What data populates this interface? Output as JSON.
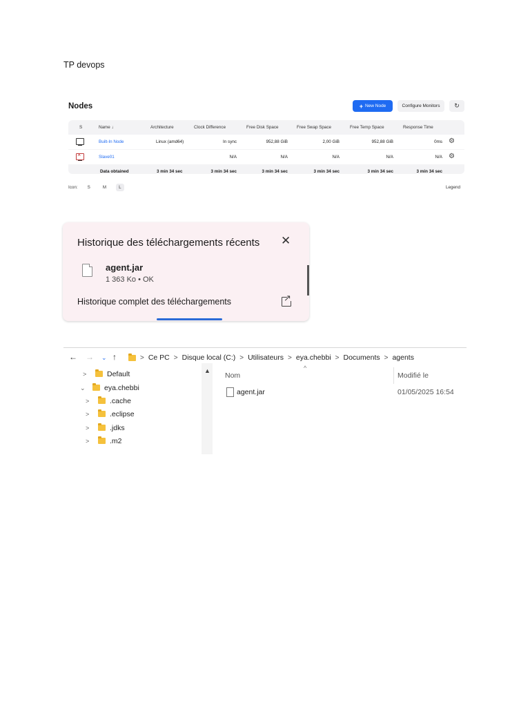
{
  "doc_title": "TP devops",
  "nodes": {
    "title": "Nodes",
    "new_node_label": "New Node",
    "configure_label": "Configure Monitors",
    "refresh_icon": "refresh-icon",
    "columns": [
      "S",
      "Name ↓",
      "Architecture",
      "Clock Difference",
      "Free Disk Space",
      "Free Swap Space",
      "Free Temp Space",
      "Response Time"
    ],
    "rows": [
      {
        "name": "Built-In Node",
        "arch": "Linux (amd64)",
        "clock": "In sync",
        "disk": "952,88 GiB",
        "swap": "2,00 GiB",
        "temp": "952,88 GiB",
        "resp": "0ms",
        "status": "online"
      },
      {
        "name": "Slave01",
        "arch": "",
        "clock": "N/A",
        "disk": "N/A",
        "swap": "N/A",
        "temp": "N/A",
        "resp": "N/A",
        "status": "offline"
      }
    ],
    "data_obtained": {
      "label": "Data obtained",
      "clock": "3 min 34 sec",
      "disk": "3 min 34 sec",
      "swap": "3 min 34 sec",
      "temp": "3 min 34 sec",
      "resp": "3 min 34 sec",
      "arch": "3 min 34 sec"
    },
    "icon_label": "Icon:",
    "icon_sizes": [
      "S",
      "M",
      "L"
    ],
    "icon_size_selected": "L",
    "legend_label": "Legend"
  },
  "downloads": {
    "title": "Historique des téléchargements récents",
    "file_name": "agent.jar",
    "file_meta": "1 363 Ko • OK",
    "full_history_label": "Historique complet des téléchargements"
  },
  "explorer": {
    "breadcrumbs": [
      "Ce PC",
      "Disque local (C:)",
      "Utilisateurs",
      "eya.chebbi",
      "Documents",
      "agents"
    ],
    "tree": [
      {
        "label": "Default",
        "expanded": false,
        "level": 0
      },
      {
        "label": "eya.chebbi",
        "expanded": true,
        "level": 0
      },
      {
        "label": ".cache",
        "expanded": false,
        "level": 1
      },
      {
        "label": ".eclipse",
        "expanded": false,
        "level": 1
      },
      {
        "label": ".jdks",
        "expanded": false,
        "level": 1
      },
      {
        "label": ".m2",
        "expanded": false,
        "level": 1
      }
    ],
    "col_name": "Nom",
    "col_modified": "Modifié le",
    "files": [
      {
        "name": "agent.jar",
        "modified": "01/05/2025 16:54"
      }
    ]
  }
}
